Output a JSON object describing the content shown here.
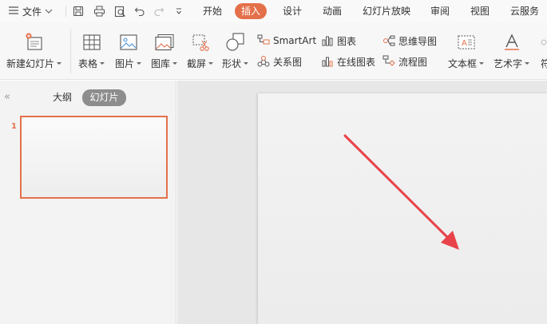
{
  "menu": {
    "file_label": "文件",
    "tabs": [
      "开始",
      "插入",
      "设计",
      "动画",
      "幻灯片放映",
      "审阅",
      "视图",
      "云服务"
    ],
    "active_tab": "插入"
  },
  "ribbon": {
    "new_slide": "新建幻灯片",
    "table": "表格",
    "picture": "图片",
    "gallery": "图库",
    "screenshot": "截屏",
    "shapes": "形状",
    "smartart": "SmartArt",
    "relation": "关系图",
    "chart": "图表",
    "online_chart": "在线图表",
    "mindmap": "思维导图",
    "flowchart": "流程图",
    "textbox": "文本框",
    "wordart": "艺术字",
    "symbol": "符"
  },
  "left_panel": {
    "tab_outline": "大纲",
    "tab_slides": "幻灯片",
    "slide_number": "1"
  },
  "colors": {
    "accent": "#e4704a",
    "annotation_arrow": "#e8434a"
  }
}
